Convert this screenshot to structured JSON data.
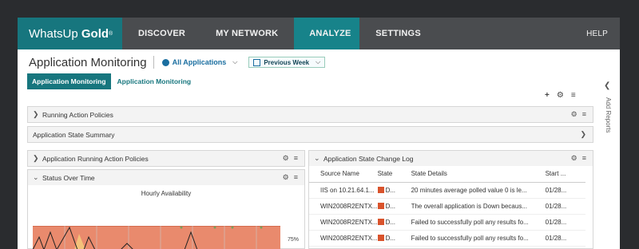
{
  "nav": {
    "logo_main": "WhatsUp",
    "logo_bold": "Gold",
    "logo_mark": "®",
    "items": [
      {
        "label": "DISCOVER"
      },
      {
        "label": "MY NETWORK"
      },
      {
        "label": "ANALYZE"
      },
      {
        "label": "SETTINGS"
      }
    ],
    "help": "HELP",
    "accent": "#17838a"
  },
  "header": {
    "title": "Application Monitoring",
    "filter": "All Applications",
    "date_range": "Previous Week"
  },
  "tabs": [
    {
      "label": "Application Monitoring",
      "active": true
    },
    {
      "label": "Application Monitoring",
      "active": false
    }
  ],
  "sidebar": {
    "add_reports": "Add Reports"
  },
  "toolbar": {
    "add_icon": "+",
    "gear_icon": "⚙",
    "menu_icon": "≡"
  },
  "panels": {
    "running": "Running Action Policies",
    "summary": "Application State Summary",
    "app_running": "Application Running Action Policies",
    "status": "Status Over Time",
    "log": "Application State Change Log"
  },
  "chart": {
    "title": "Hourly Availability",
    "tick_label": "75%"
  },
  "log": {
    "columns": [
      "Source Name",
      "State",
      "State Details",
      "Start ..."
    ],
    "rows": [
      {
        "source": "IIS on 10.21.64.1...",
        "state": "D...",
        "details": "20 minutes average polled value 0 is le...",
        "start": "01/28..."
      },
      {
        "source": "WIN2008R2ENTX...",
        "state": "D...",
        "details": "The overall application is Down becaus...",
        "start": "01/28..."
      },
      {
        "source": "WIN2008R2ENTX...",
        "state": "D...",
        "details": "Failed to successfully poll any results fo...",
        "start": "01/28..."
      },
      {
        "source": "WIN2008R2ENTX...",
        "state": "D...",
        "details": "Failed to successfully poll any results fo...",
        "start": "01/28..."
      }
    ]
  }
}
